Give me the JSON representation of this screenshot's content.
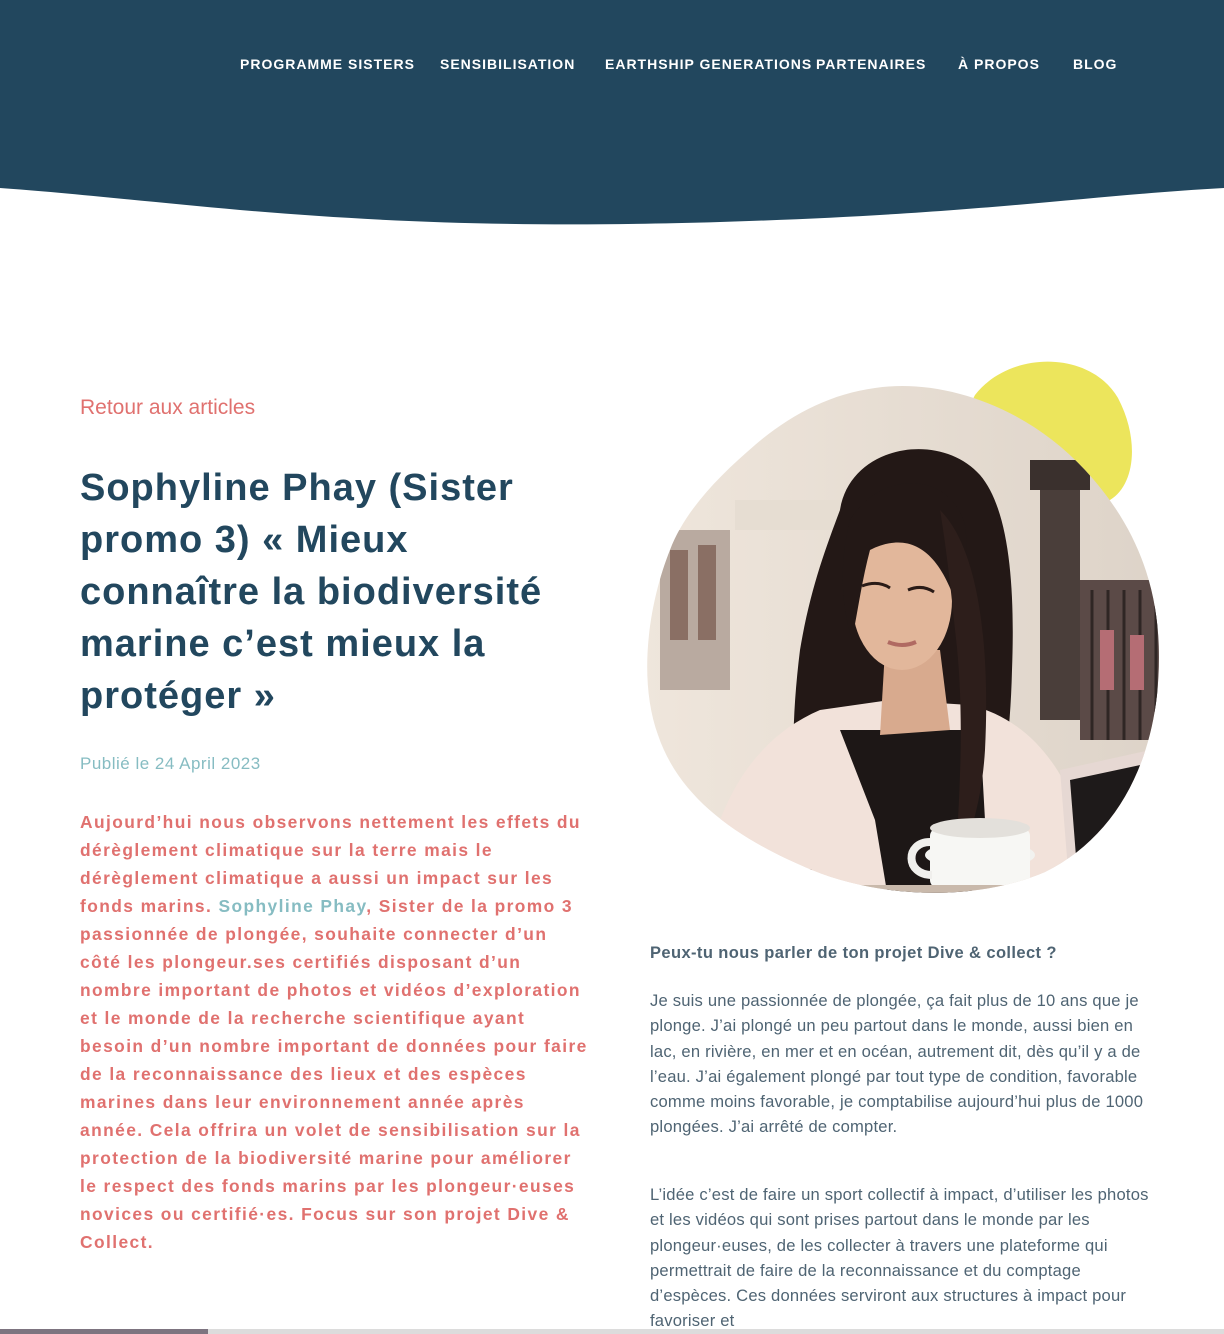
{
  "colors": {
    "header_bg": "#22475e",
    "accent_coral": "#e0716f",
    "accent_teal": "#86bcc2",
    "blob_yellow": "#ece55c",
    "text_body": "#4f6473"
  },
  "nav": {
    "items": [
      {
        "label": "PROGRAMME SISTERS"
      },
      {
        "label": "SENSIBILISATION"
      },
      {
        "label": "EARTHSHIP GENERATIONS"
      },
      {
        "label": "PARTENAIRES"
      },
      {
        "label": "À PROPOS"
      },
      {
        "label": "BLOG"
      }
    ]
  },
  "article": {
    "back_label": "Retour aux articles",
    "title": "Sophyline Phay (Sister promo 3) « Mieux connaître la biodiversité marine c’est mieux la protéger »",
    "published": "Publié le 24 April 2023",
    "intro_before": "Aujourd’hui nous observons nettement les effets du dérèglement climatique sur la terre mais le dérèglement climatique a aussi un impact sur les fonds marins. ",
    "intro_name": "Sophyline Phay",
    "intro_after": ", Sister de la promo 3 passionnée de plongée, souhaite connecter d’un côté les plongeur.ses certifiés disposant d’un nombre important de photos et vidéos d’exploration et le monde de la recherche scientifique ayant besoin d’un nombre important de données pour faire de la reconnaissance des lieux et des espèces marines dans leur environnement année après année. Cela offrira un volet de sensibilisation sur la protection de la biodiversité marine pour améliorer le respect des fonds marins par les plongeur·euses novices ou certifié·es. Focus sur son projet Dive & Collect.",
    "question": "Peux-tu nous parler de ton projet Dive & collect ?",
    "paragraph1": "Je suis une passionnée de plongée, ça fait plus de 10 ans que je plonge. J’ai plongé un peu partout dans le monde, aussi bien en lac, en rivière, en mer et en océan, autrement dit, dès qu’il y a de l’eau. J’ai également plongé par tout type de condition, favorable comme moins favorable, je comptabilise aujourd’hui plus de 1000 plongées. J’ai arrêté de compter.",
    "paragraph2": "L’idée c’est de faire un sport collectif à impact, d’utiliser les photos et les vidéos qui sont prises partout dans le monde par les plongeur·euses, de les collecter à travers une plateforme qui permettrait de faire de la reconnaissance et du comptage d’espèces. Ces données serviront aux structures à impact pour favoriser et"
  },
  "photo": {
    "subject": "woman-at-laptop-with-coffee-cup"
  }
}
